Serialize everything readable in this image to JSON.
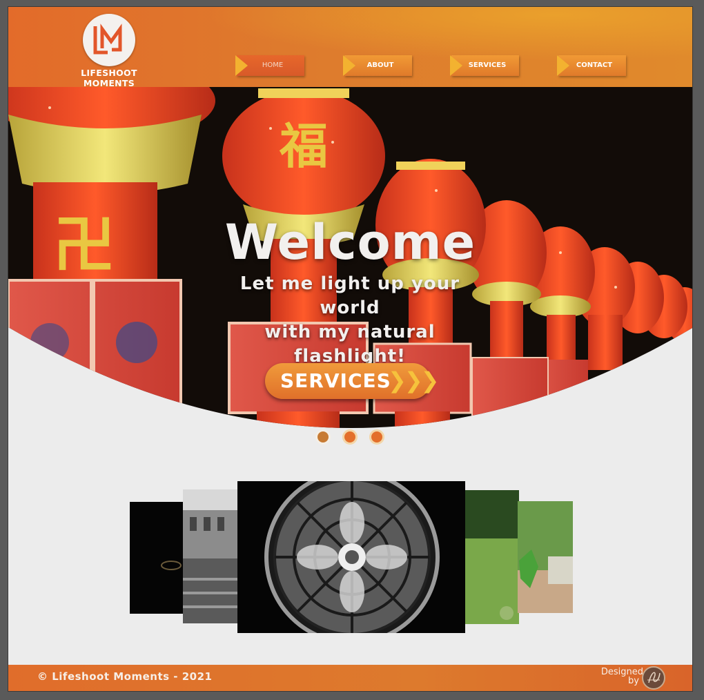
{
  "brand": {
    "name": "LIFESHOOT MOMENTS",
    "logo_icon": "lm-monogram-icon",
    "logo_color": "#e2562a"
  },
  "nav": {
    "items": [
      {
        "label": "HOME",
        "active": true
      },
      {
        "label": "ABOUT",
        "active": false
      },
      {
        "label": "SERVICES",
        "active": false
      },
      {
        "label": "CONTACT",
        "active": false
      }
    ]
  },
  "hero": {
    "title": "Welcome",
    "tagline_lines": [
      "Let me light up your world",
      "with my natural",
      "flashlight!"
    ],
    "cta_label": "SERVICES",
    "cta_icon": "triple-chevron-right-icon",
    "slides_total": 3,
    "active_slide": 1,
    "background": "red-chinese-lanterns-photo"
  },
  "gallery": {
    "images": [
      "dark-ring-photo",
      "blurred-building-bw-photo",
      "rose-window-bw-photo",
      "green-blur-photo",
      "green-leaf-photo"
    ],
    "active": 3
  },
  "footer": {
    "copyright": "© Lifeshoot Moments - 2021",
    "designed_line1": "Designed",
    "designed_line2": "by",
    "signature_icon": "sa-signature-icon"
  },
  "colors": {
    "accent": "#e07a2a",
    "arrow": "#f3b230",
    "page_bg": "#ececec"
  }
}
